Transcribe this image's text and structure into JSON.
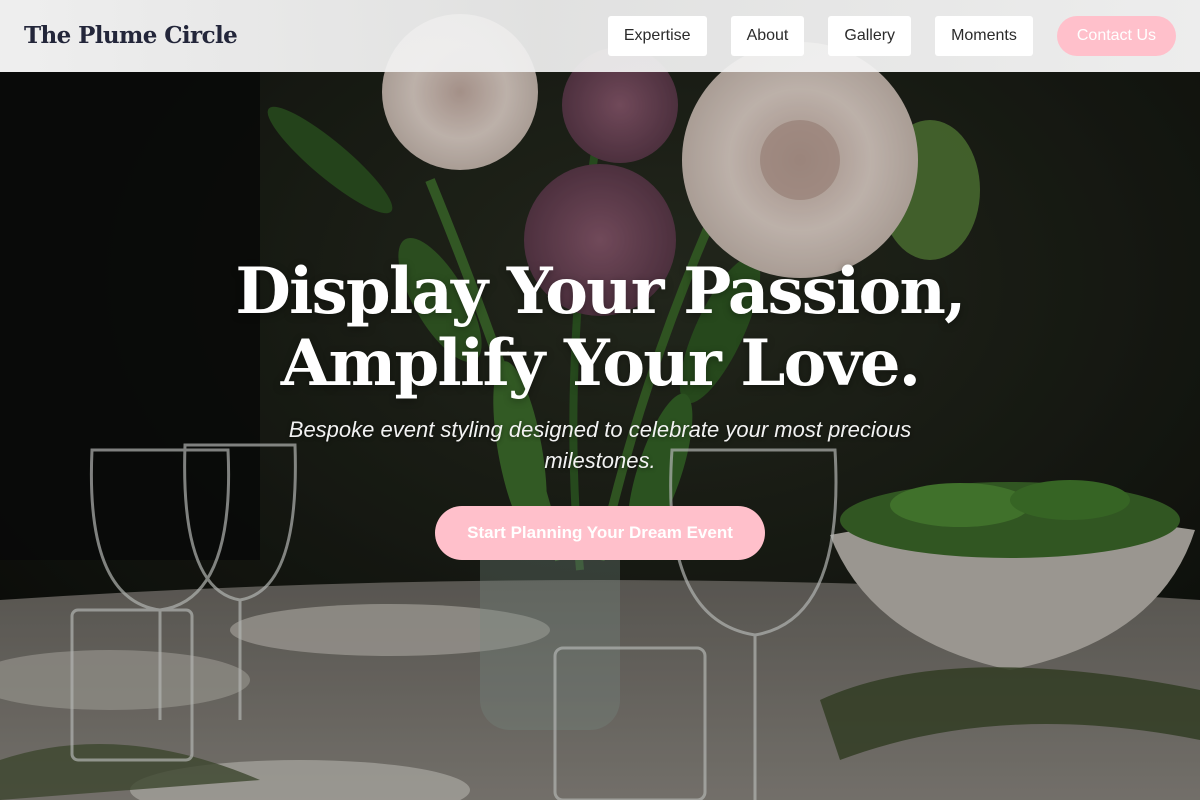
{
  "header": {
    "brand": "The Plume Circle",
    "nav": [
      {
        "label": "Expertise"
      },
      {
        "label": "About"
      },
      {
        "label": "Gallery"
      },
      {
        "label": "Moments"
      }
    ],
    "contact_label": "Contact Us"
  },
  "hero": {
    "title_line1": "Display Your Passion,",
    "title_line2": "Amplify Your Love.",
    "subtitle": "Bespoke event styling designed to celebrate your most precious milestones.",
    "cta_label": "Start Planning Your Dream Event"
  },
  "colors": {
    "accent_pink": "#ffc0cb",
    "brand_text": "#23263a",
    "hero_text": "#ffffff"
  }
}
